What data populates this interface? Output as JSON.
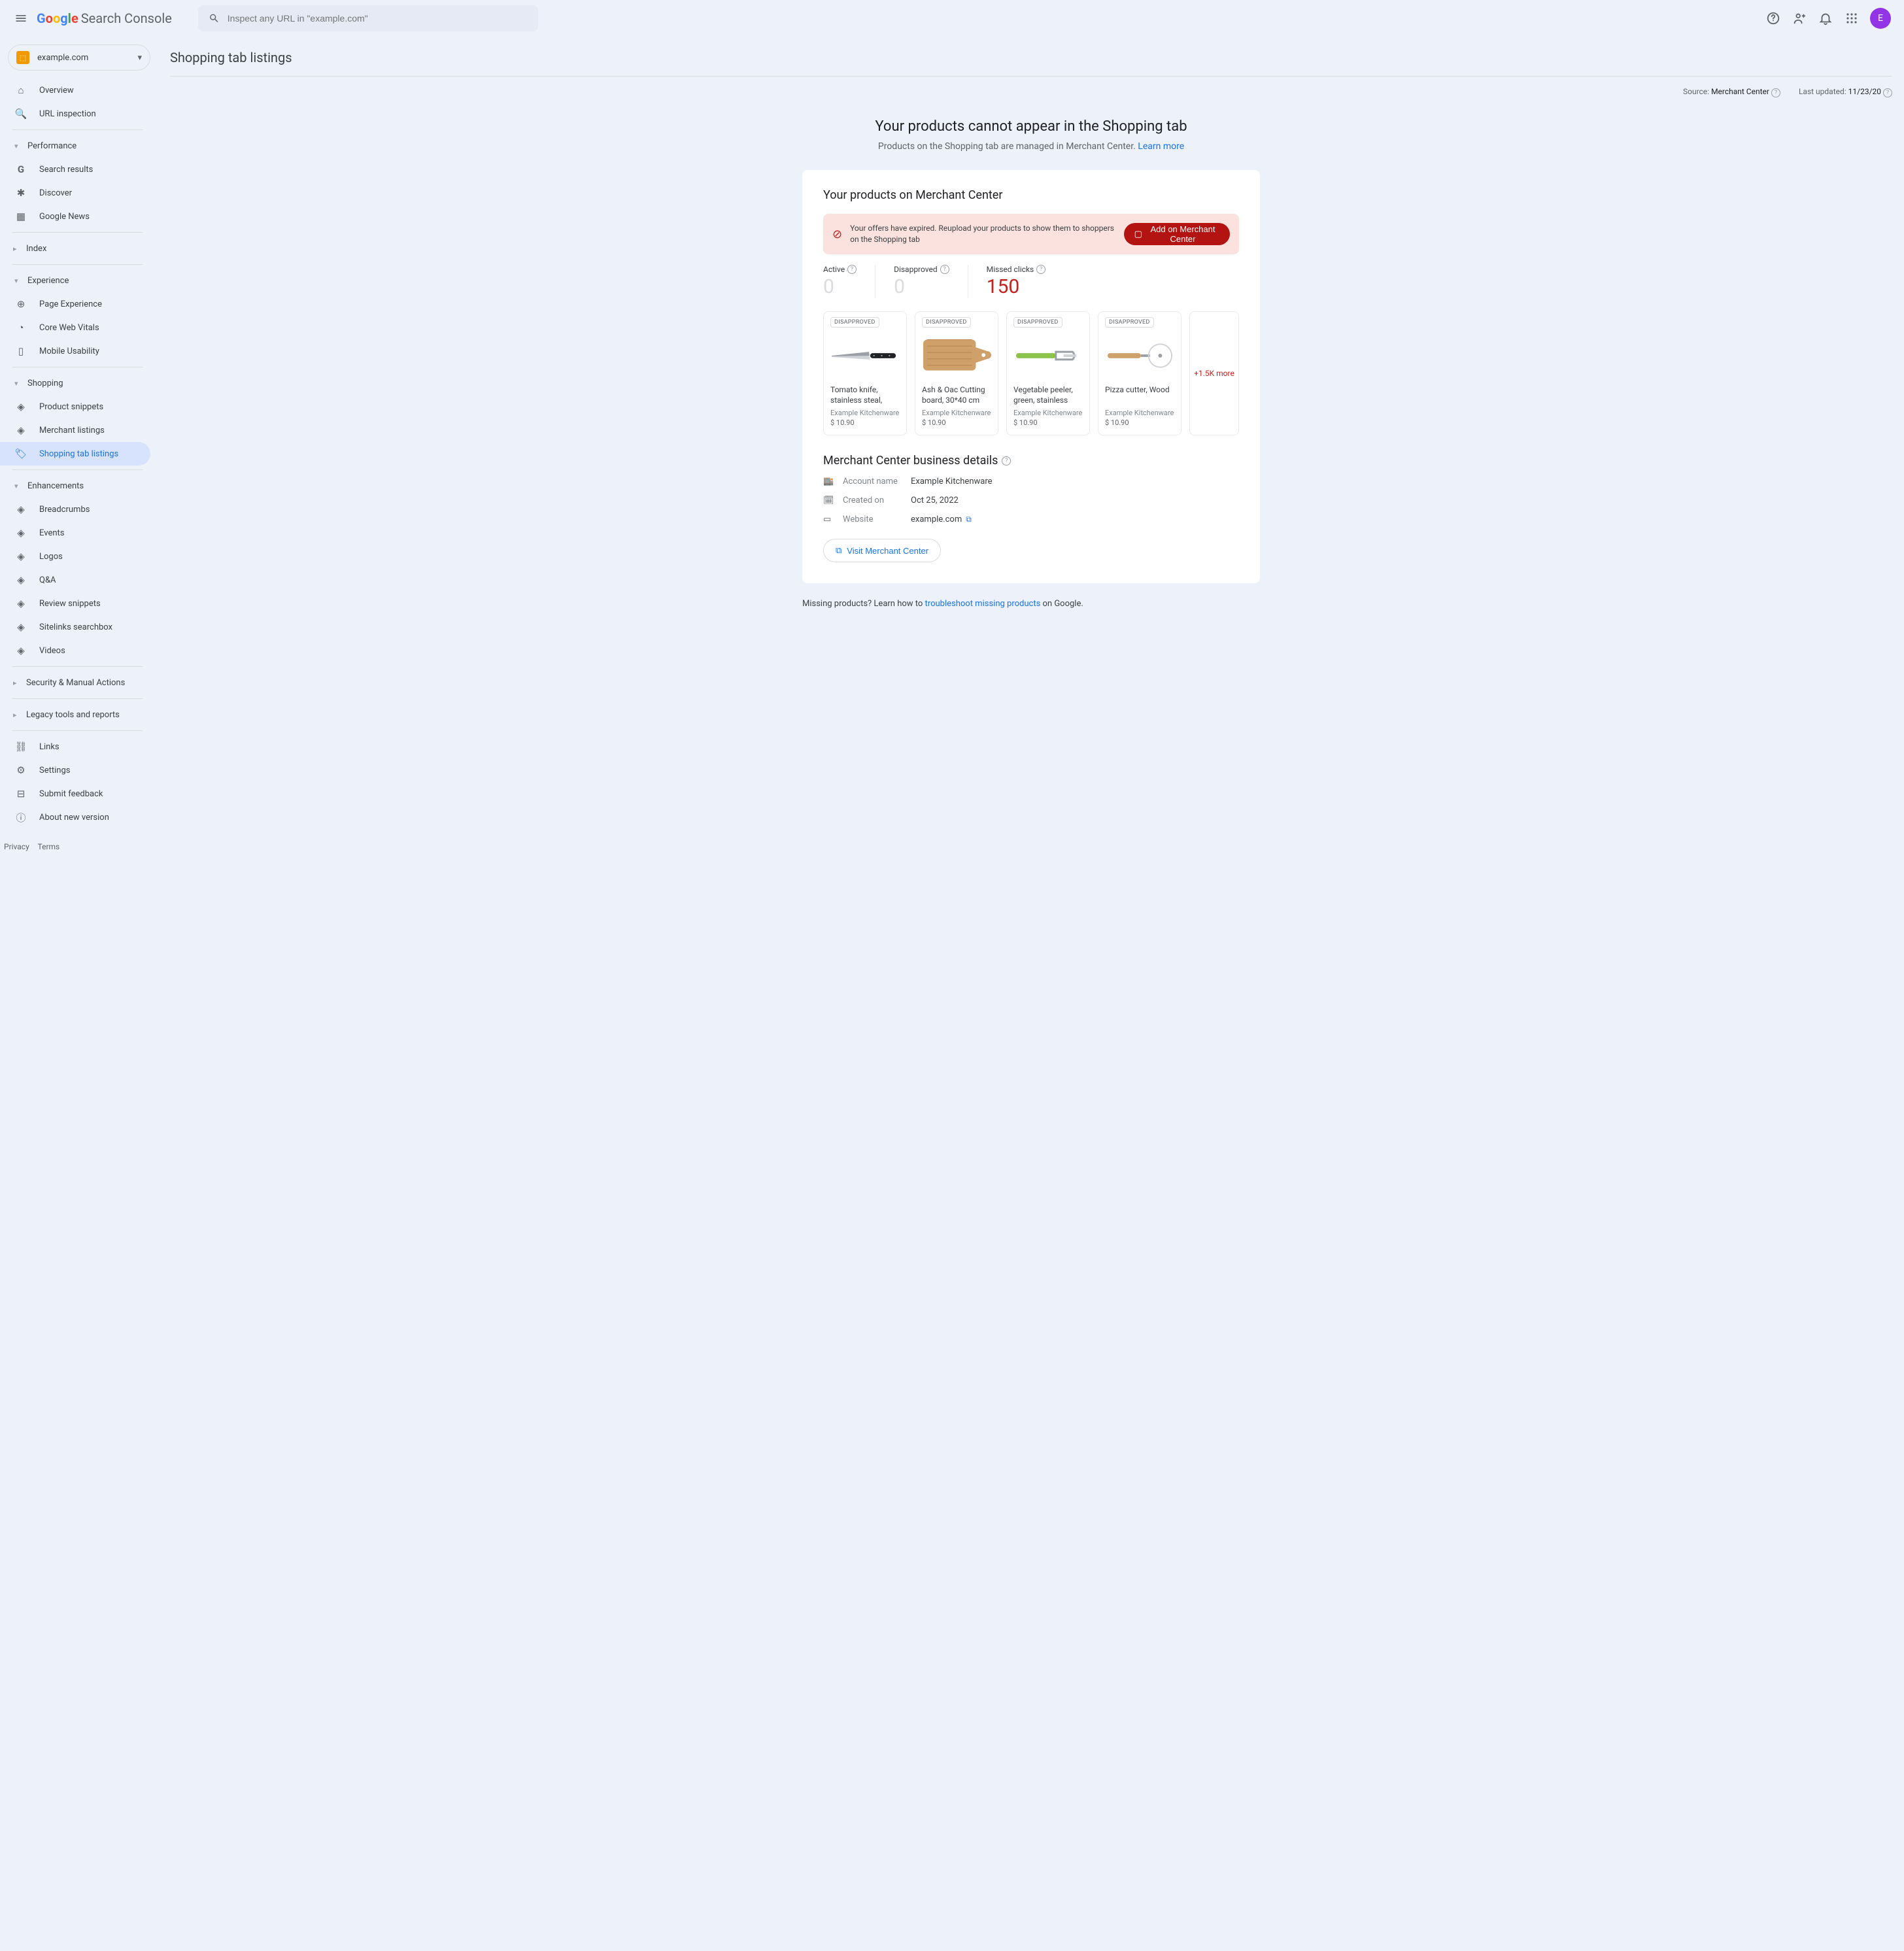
{
  "header": {
    "product_name": "Search Console",
    "search_placeholder": "Inspect any URL in \"example.com\"",
    "avatar_letter": "E"
  },
  "property": {
    "domain": "example.com"
  },
  "sidebar": {
    "overview": "Overview",
    "url_inspection": "URL inspection",
    "performance": "Performance",
    "search_results": "Search results",
    "discover": "Discover",
    "google_news": "Google News",
    "index": "Index",
    "experience": "Experience",
    "page_experience": "Page Experience",
    "core_web_vitals": "Core Web Vitals",
    "mobile_usability": "Mobile Usability",
    "shopping": "Shopping",
    "product_snippets": "Product snippets",
    "merchant_listings": "Merchant listings",
    "shopping_tab_listings": "Shopping tab listings",
    "enhancements": "Enhancements",
    "breadcrumbs": "Breadcrumbs",
    "events": "Events",
    "logos": "Logos",
    "qa": "Q&A",
    "review_snippets": "Review snippets",
    "sitelinks_searchbox": "Sitelinks searchbox",
    "videos": "Videos",
    "security": "Security & Manual Actions",
    "legacy": "Legacy tools and reports",
    "links": "Links",
    "settings": "Settings",
    "submit_feedback": "Submit feedback",
    "about": "About new version"
  },
  "page": {
    "title": "Shopping tab listings",
    "source_label": "Source:",
    "source_value": "Merchant Center",
    "updated_label": "Last updated:",
    "updated_value": "11/23/20",
    "hero_title": "Your products cannot appear in the Shopping tab",
    "hero_sub": "Products on the Shopping tab are managed in Merchant Center. ",
    "learn_more": "Learn more",
    "card_title": "Your products on Merchant Center",
    "alert_msg": "Your offers have expired. Reupload your products to show them to shoppers on the Shopping tab",
    "alert_btn": "Add on Merchant Center",
    "stats": {
      "active_label": "Active",
      "active_value": "0",
      "disapproved_label": "Disapproved",
      "disapproved_value": "0",
      "missed_label": "Missed clicks",
      "missed_value": "150"
    },
    "disapproved_badge": "DISAPPROVED",
    "products": [
      {
        "name": "Tomato knife, stainless steal, black",
        "brand": "Example Kitchenware",
        "price": "$ 10.90"
      },
      {
        "name": "Ash & Oac Cutting board, 30*40 cm",
        "brand": "Example Kitchenware",
        "price": "$ 10.90"
      },
      {
        "name": "Vegetable peeler, green, stainless ste…",
        "brand": "Example Kitchenware",
        "price": "$ 10.90"
      },
      {
        "name": "Pizza cutter, Wood",
        "brand": "Example Kitchenware",
        "price": "$ 10.90"
      }
    ],
    "more": "+1.5K more",
    "biz_title": "Merchant Center business details",
    "account_label": "Account name",
    "account_value": "Example Kitchenware",
    "created_label": "Created on",
    "created_value": "Oct 25, 2022",
    "website_label": "Website",
    "website_value": "example.com",
    "visit_btn": "Visit Merchant Center",
    "footer_pre": "Missing products? Learn how to ",
    "footer_link": "troubleshoot missing products",
    "footer_post": " on Google."
  },
  "legal": {
    "privacy": "Privacy",
    "terms": "Terms"
  }
}
